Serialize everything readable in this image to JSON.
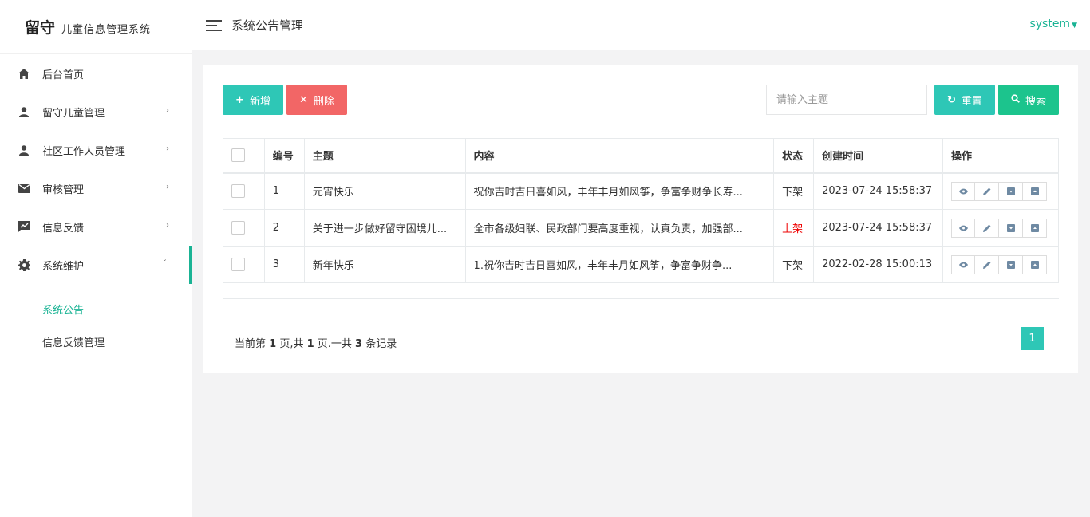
{
  "logo": {
    "main": "留守",
    "sub": "儿童信息管理系统"
  },
  "sidebar": {
    "items": [
      {
        "label": "后台首页",
        "icon": "home-icon",
        "arrow": ""
      },
      {
        "label": "留守儿童管理",
        "icon": "user-icon",
        "arrow": "›"
      },
      {
        "label": "社区工作人员管理",
        "icon": "user-icon",
        "arrow": "›"
      },
      {
        "label": "审核管理",
        "icon": "envelope-icon",
        "arrow": "›"
      },
      {
        "label": "信息反馈",
        "icon": "feedback-icon",
        "arrow": "›"
      },
      {
        "label": "系统维护",
        "icon": "gear-icon",
        "arrow": "ˇ"
      }
    ],
    "submenu": [
      {
        "label": "系统公告"
      },
      {
        "label": "信息反馈管理"
      }
    ]
  },
  "header": {
    "title": "系统公告管理",
    "user": "system"
  },
  "toolbar": {
    "add_label": "新增",
    "delete_label": "删除",
    "search_placeholder": "请输入主题",
    "reset_label": "重置",
    "search_label": "搜索"
  },
  "table": {
    "headers": [
      "编号",
      "主题",
      "内容",
      "状态",
      "创建时间",
      "操作"
    ],
    "rows": [
      {
        "id": "1",
        "subject": "元宵快乐",
        "content": "祝你吉时吉日喜如风，丰年丰月如风筝，争富争财争长寿...",
        "status": "下架",
        "created": "2023-07-24 15:58:37"
      },
      {
        "id": "2",
        "subject": "关于进一步做好留守困境儿...",
        "content": "全市各级妇联、民政部门要高度重视，认真负责，加强部...",
        "status": "上架",
        "created": "2023-07-24 15:58:37"
      },
      {
        "id": "3",
        "subject": "新年快乐",
        "content": "1.祝你吉时吉日喜如风，丰年丰月如风筝，争富争财争...",
        "status": "下架",
        "created": "2022-02-28 15:00:13"
      }
    ]
  },
  "pager": {
    "text_prefix": "当前第 ",
    "current": "1",
    "text_mid1": " 页,共 ",
    "total_pages": "1",
    "text_mid2": " 页.一共 ",
    "total_records": "3",
    "text_suffix": " 条记录",
    "page_button": "1"
  },
  "colors": {
    "accent": "#2ec7b6",
    "danger": "#f26666",
    "search": "#1cc48d",
    "active_menu": "#1ab394"
  }
}
